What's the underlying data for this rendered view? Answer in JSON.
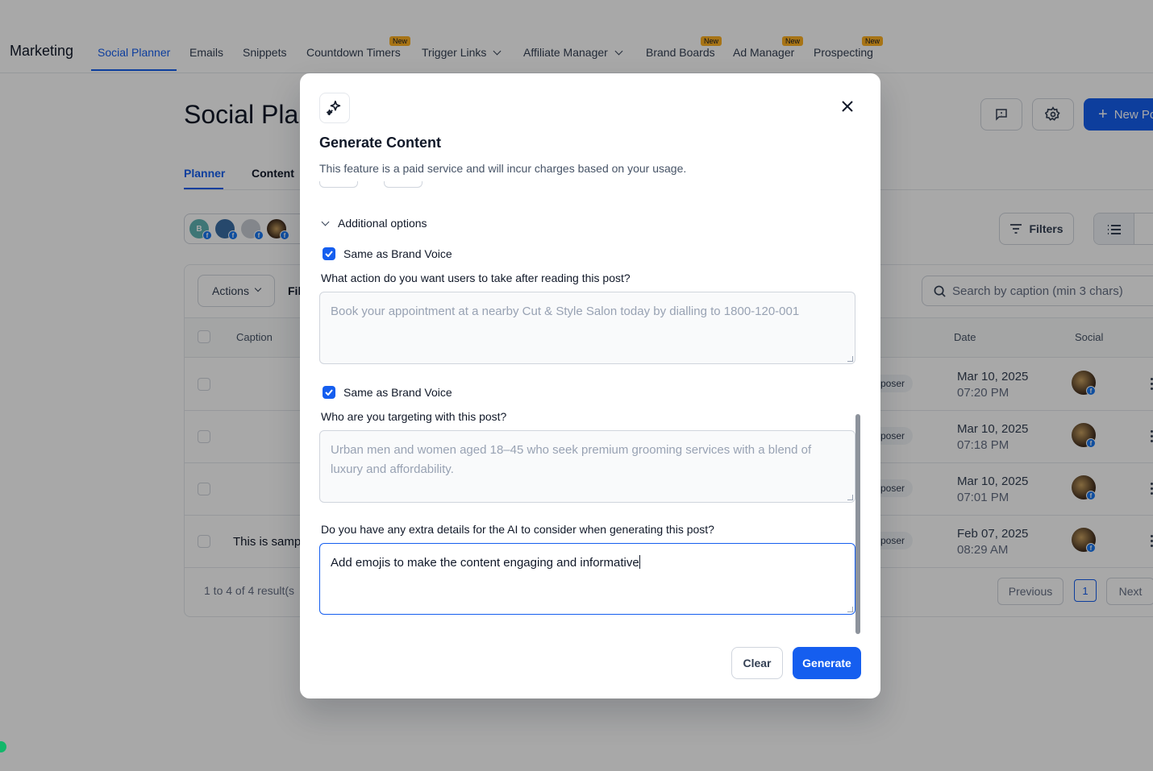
{
  "app": {
    "brand": "Marketing",
    "nav": [
      {
        "label": "Social Planner",
        "active": true
      },
      {
        "label": "Emails"
      },
      {
        "label": "Snippets"
      },
      {
        "label": "Countdown Timers",
        "badge": "New"
      },
      {
        "label": "Trigger Links",
        "dropdown": true
      },
      {
        "label": "Affiliate Manager",
        "dropdown": true
      },
      {
        "label": "Brand Boards",
        "badge": "New"
      },
      {
        "label": "Ad Manager",
        "badge": "New"
      },
      {
        "label": "Prospecting",
        "badge": "New"
      }
    ]
  },
  "page": {
    "title": "Social Plan",
    "new_post_label": "New Po",
    "tabs": [
      "Planner",
      "Content"
    ],
    "account_initial": "B",
    "filters_label": "Filters",
    "actions_label": "Actions",
    "filter_label_partial": "Fil",
    "search_placeholder": "Search by caption (min 3 chars)",
    "columns": {
      "caption": "Caption",
      "date": "Date",
      "social": "Social"
    },
    "rows": [
      {
        "caption": "",
        "status": "poser",
        "date": "Mar 10, 2025",
        "time": "07:20 PM"
      },
      {
        "caption": "",
        "status": "poser",
        "date": "Mar 10, 2025",
        "time": "07:18 PM"
      },
      {
        "caption": "",
        "status": "poser",
        "date": "Mar 10, 2025",
        "time": "07:01 PM"
      },
      {
        "caption": "This is samp",
        "status": "poser",
        "date": "Feb 07, 2025",
        "time": "08:29 AM"
      }
    ],
    "results_text": "1 to 4 of 4 result(s",
    "pagination": {
      "previous": "Previous",
      "current": "1",
      "next": "Next"
    }
  },
  "modal": {
    "title": "Generate Content",
    "subtitle": "This feature is a paid service and will incur charges based on your usage.",
    "additional_options": "Additional options",
    "brand_voice_1": {
      "label": "Same as Brand Voice",
      "checked": true
    },
    "q_action": "What action do you want users to take after reading this post?",
    "action_placeholder": "Book your appointment at a nearby Cut & Style Salon today by dialling to 1800-120-001",
    "brand_voice_2": {
      "label": "Same as Brand Voice",
      "checked": true
    },
    "q_target": "Who are you targeting with this post?",
    "target_placeholder": "Urban men and women aged 18–45 who seek premium grooming services with a blend of luxury and affordability.",
    "q_extra": "Do you have any extra details for the AI to consider when generating this post?",
    "extra_value": "Add emojis to make the content engaging and informative",
    "clear_label": "Clear",
    "generate_label": "Generate"
  },
  "colors": {
    "primary": "#155eef",
    "badge": "#fdb022",
    "facebook": "#1877f2"
  }
}
